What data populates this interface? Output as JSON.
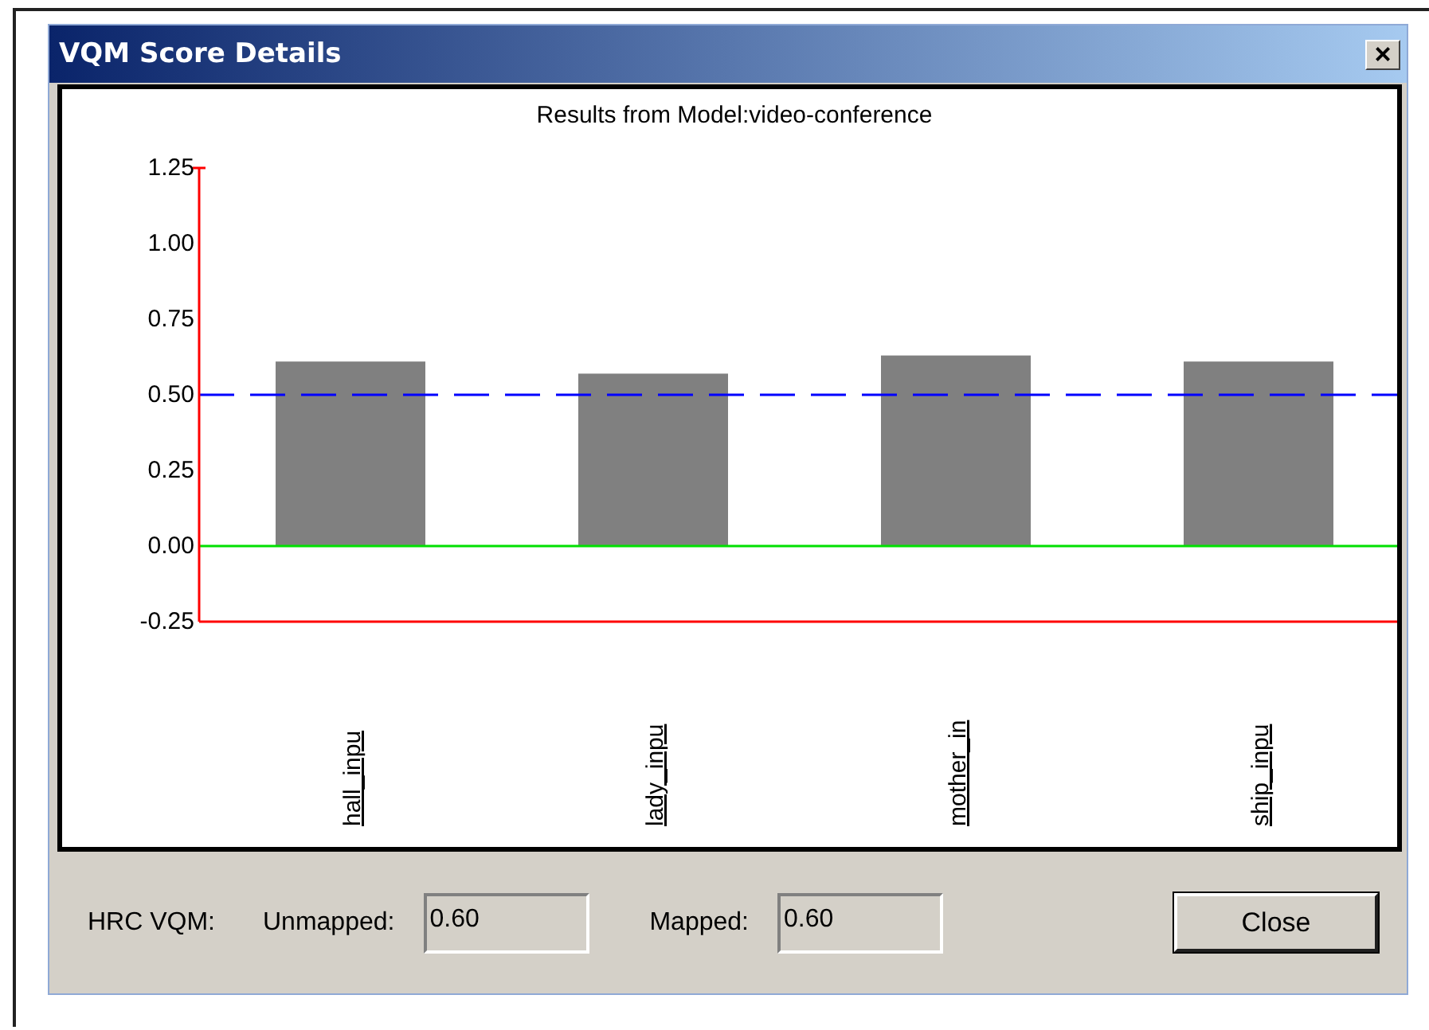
{
  "window": {
    "title": "VQM Score Details",
    "close_icon": "×"
  },
  "chart": {
    "chart_data": {
      "type": "bar",
      "title": "Results from Model:video-conference",
      "categories": [
        "hall_inpu",
        "lady_inpu",
        "mother_in",
        "ship_inpu"
      ],
      "values": [
        0.61,
        0.57,
        0.63,
        0.61
      ],
      "ylim": [
        -0.25,
        1.25
      ],
      "yticks": [
        {
          "value": 1.25,
          "label": "1.25"
        },
        {
          "value": 1.0,
          "label": "1.00"
        },
        {
          "value": 0.75,
          "label": "0.75"
        },
        {
          "value": 0.5,
          "label": "0.50"
        },
        {
          "value": 0.25,
          "label": "0.25"
        },
        {
          "value": 0,
          "label": "0.00"
        },
        {
          "value": -0.25,
          "label": "-0.25"
        }
      ],
      "ref_lines": [
        {
          "axis": "y",
          "value": 0.5,
          "color": "#0000ff"
        },
        {
          "axis": "y",
          "value": 0,
          "color": "#00e000"
        }
      ]
    }
  },
  "footer": {
    "label": "HRC VQM:",
    "unmapped_label": "Unmapped:",
    "unmapped_value": "0.60",
    "mapped_label": "Mapped:",
    "mapped_value": "0.60",
    "button": "Close"
  }
}
